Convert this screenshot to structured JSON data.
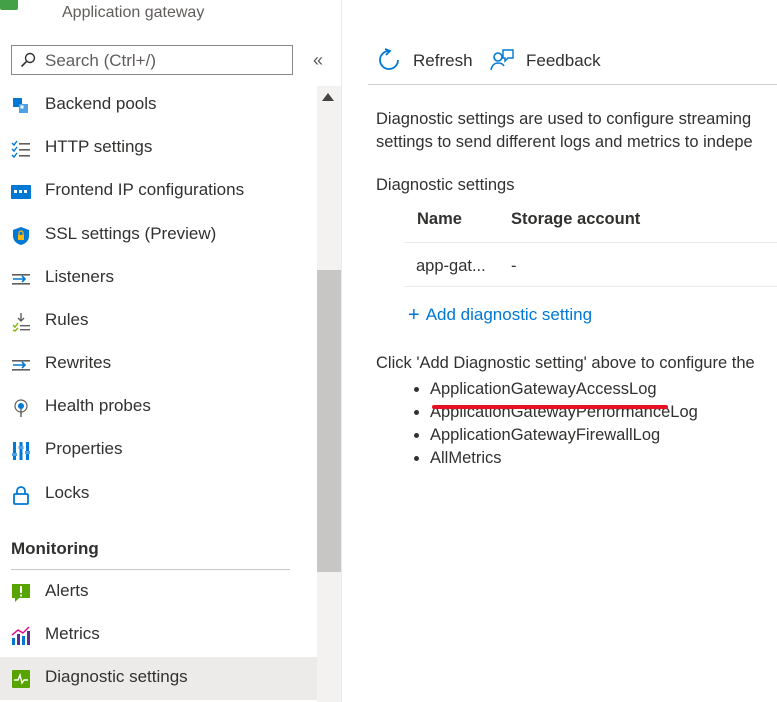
{
  "header": {
    "subtitle": "Application gateway"
  },
  "sidebar": {
    "search_placeholder": "Search (Ctrl+/)",
    "collapse_glyph": "«",
    "items": [
      {
        "label": "Backend pools",
        "icon": "backend-pools-icon"
      },
      {
        "label": "HTTP settings",
        "icon": "http-settings-icon"
      },
      {
        "label": "Frontend IP configurations",
        "icon": "frontend-ip-icon"
      },
      {
        "label": "SSL settings (Preview)",
        "icon": "shield-icon"
      },
      {
        "label": "Listeners",
        "icon": "listeners-icon"
      },
      {
        "label": "Rules",
        "icon": "rules-icon"
      },
      {
        "label": "Rewrites",
        "icon": "rewrites-icon"
      },
      {
        "label": "Health probes",
        "icon": "health-probes-icon"
      },
      {
        "label": "Properties",
        "icon": "properties-icon"
      },
      {
        "label": "Locks",
        "icon": "lock-icon"
      }
    ],
    "monitoring_title": "Monitoring",
    "monitoring_items": [
      {
        "label": "Alerts",
        "icon": "alerts-icon"
      },
      {
        "label": "Metrics",
        "icon": "metrics-icon"
      },
      {
        "label": "Diagnostic settings",
        "icon": "diagnostic-settings-icon",
        "active": true
      }
    ]
  },
  "toolbar": {
    "refresh_label": "Refresh",
    "feedback_label": "Feedback"
  },
  "main": {
    "description_line1": "Diagnostic settings are used to configure streaming",
    "description_line2": "settings to send different logs and metrics to indepe",
    "diag_heading": "Diagnostic settings",
    "table": {
      "headers": [
        "Name",
        "Storage account"
      ],
      "rows": [
        [
          "app-gat...",
          "-"
        ]
      ]
    },
    "add_link": "Add diagnostic setting",
    "click_text": "Click 'Add Diagnostic setting' above to configure the",
    "logs": [
      "ApplicationGatewayAccessLog",
      "ApplicationGatewayPerformanceLog",
      "ApplicationGatewayFirewallLog",
      "AllMetrics"
    ]
  },
  "colors": {
    "accent": "#0078d4",
    "highlight_underline": "#e81123"
  }
}
